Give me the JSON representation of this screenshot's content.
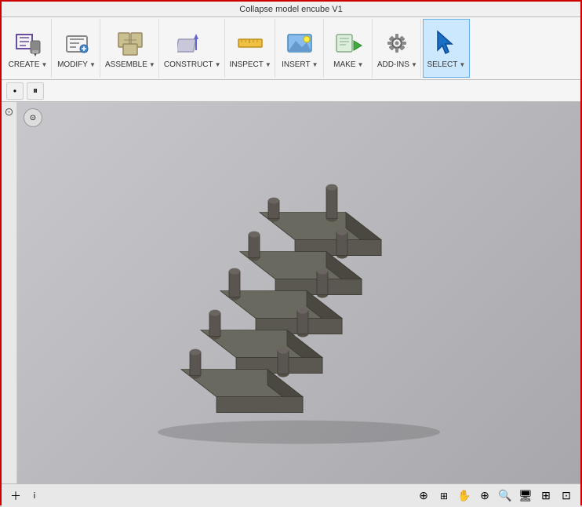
{
  "title": "Collapse model encube V1",
  "toolbar": {
    "groups": [
      {
        "id": "create",
        "label": "CREATE",
        "icon": "create",
        "hasDropdown": true
      },
      {
        "id": "modify",
        "label": "MODIFY",
        "icon": "modify",
        "hasDropdown": true
      },
      {
        "id": "assemble",
        "label": "ASSEMBLE",
        "icon": "assemble",
        "hasDropdown": true
      },
      {
        "id": "construct",
        "label": "CONSTRUCT",
        "icon": "construct",
        "hasDropdown": true
      },
      {
        "id": "inspect",
        "label": "INSPECT",
        "icon": "inspect",
        "hasDropdown": true
      },
      {
        "id": "insert",
        "label": "INSERT",
        "icon": "insert",
        "hasDropdown": true
      },
      {
        "id": "make",
        "label": "MAKE",
        "icon": "make",
        "hasDropdown": true
      },
      {
        "id": "addins",
        "label": "ADD-INS",
        "icon": "addins",
        "hasDropdown": true
      },
      {
        "id": "select",
        "label": "SELECT",
        "icon": "select",
        "hasDropdown": true,
        "active": true
      }
    ]
  },
  "toolbar2": {
    "buttons": [
      {
        "id": "dot",
        "label": "•"
      },
      {
        "id": "pause",
        "label": "⏸"
      }
    ]
  },
  "viewport": {
    "nav_circle_label": "⊙"
  },
  "status_bar": {
    "left_icons": [
      "+",
      "i"
    ],
    "right_icons": [
      "⊕",
      "⊞",
      "✋",
      "⊕",
      "🔍",
      "🖥",
      "⊞",
      "⊡"
    ]
  }
}
